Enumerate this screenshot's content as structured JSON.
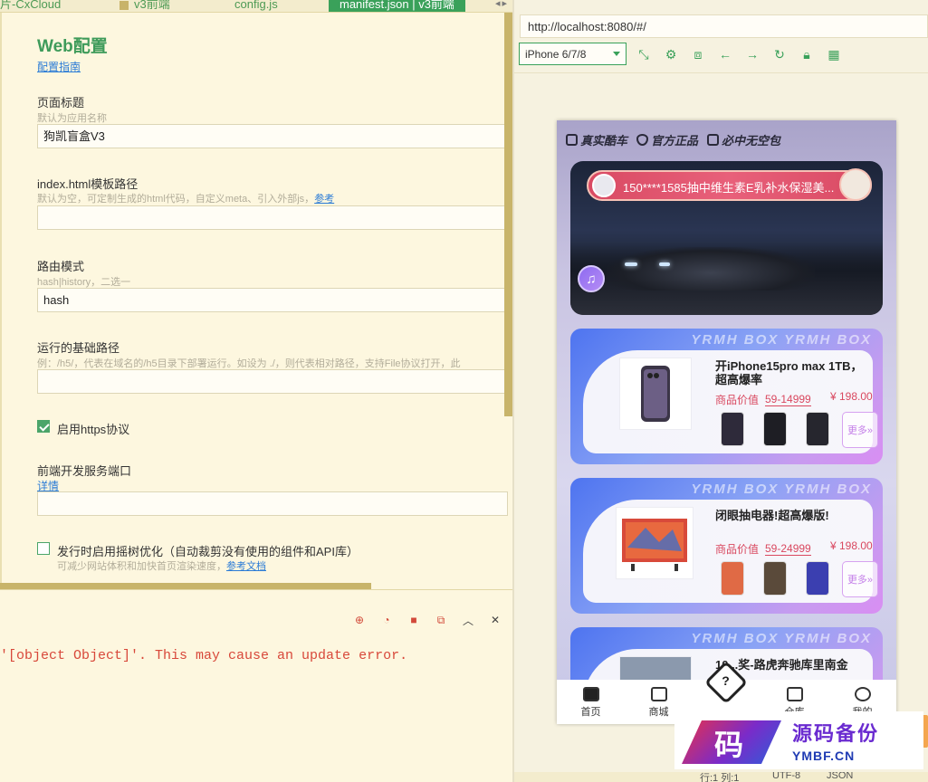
{
  "tabs": [
    {
      "label": "片-CxCloud",
      "active": false
    },
    {
      "label": "v3前端",
      "active": false
    },
    {
      "label": "config.js",
      "active": false
    },
    {
      "label": "manifest.json | v3前端",
      "active": true
    }
  ],
  "settings": {
    "title": "Web配置",
    "guide_link": "配置指南",
    "fields": [
      {
        "label": "页面标题",
        "hint": "默认为应用名称",
        "value": ""
      },
      {
        "label": "index.html模板路径",
        "hint": "默认为空，可定制生成的html代码，自定义meta、引入外部js，",
        "hint_link": "参考",
        "value": ""
      },
      {
        "label": "路由模式",
        "hint": "hash|history，二选一",
        "value": "hash"
      },
      {
        "label": "运行的基础路径",
        "hint": "例：/h5/，代表在域名的/h5目录下部署运行。如设为 ./，则代表相对路径，支持File协议打开，此",
        "value": ""
      },
      {
        "label": "前端开发服务端口",
        "hint_link": "详情",
        "value": ""
      }
    ],
    "page_title_value": "狗凯盲盒V3",
    "https_label": "启用https协议",
    "https_checked": true,
    "treeshake_label": "发行时启用摇树优化（自动裁剪没有使用的组件和API库）",
    "treeshake_checked": false,
    "treeshake_hint": "可减少网站体积和加快首页渲染速度，",
    "treeshake_link": "参考文档"
  },
  "console": {
    "message": "'[object Object]'. This may cause an update error."
  },
  "browser": {
    "url": "http://localhost:8080/#/",
    "device": "iPhone 6/7/8"
  },
  "phone": {
    "badges": [
      "真实酷车",
      "官方正品",
      "必中无空包"
    ],
    "banner_text": "150****1585抽中维生素E乳补水保湿美...",
    "watermark": "YRMH BOX YRMH BOX",
    "cards": [
      {
        "title": "开iPhone15pro max 1TB，超高爆率",
        "price_label": "商品价值",
        "price_range": "59-14999",
        "price": "¥ 198.00",
        "more": "更多»"
      },
      {
        "title": "闭眼抽电器!超高爆版!",
        "price_label": "商品价值",
        "price_range": "59-24999",
        "price": "¥ 198.00",
        "more": "更多»"
      },
      {
        "title": "10...奖-路虎奔驰库里南金",
        "price_label": "",
        "price_range": "",
        "price": "",
        "more": ""
      }
    ],
    "nav": [
      "首页",
      "商城",
      "盒子",
      "仓库",
      "我的"
    ]
  },
  "logo": {
    "char": "码",
    "cn": "源码备份",
    "en": "YMBF.CN"
  },
  "statusbar": {
    "pos": "行:1 列:1",
    "encoding": "UTF-8",
    "lang": "JSON"
  }
}
